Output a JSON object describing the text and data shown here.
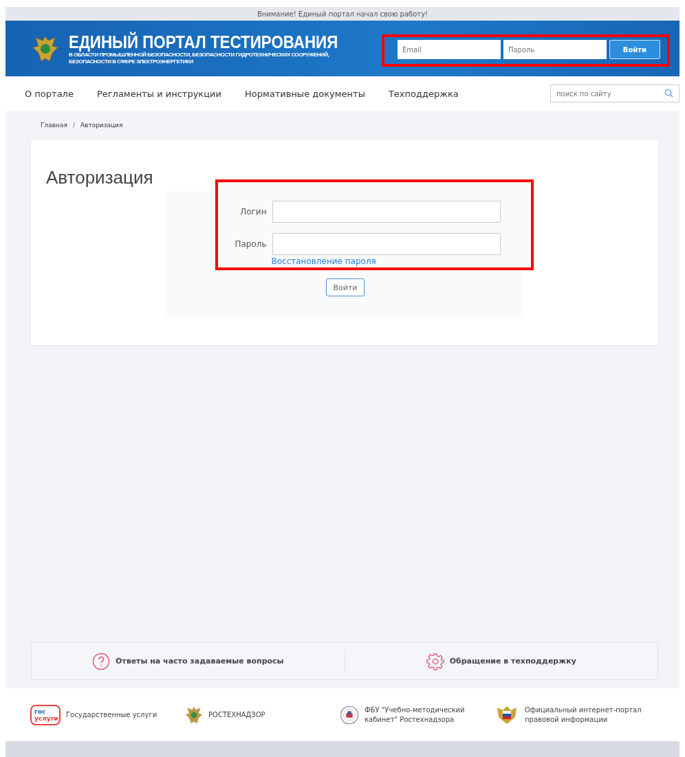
{
  "notice": "Внимание! Единый портал начал свою работу!",
  "header": {
    "title": "ЕДИНЫЙ ПОРТАЛ ТЕСТИРОВАНИЯ",
    "subtitle_lines": [
      "В ОБЛАСТИ ПРОМЫШЛЕННОЙ БЕЗОПАСНОСТИ, БЕЗОПАСНОСТИ ГИДРОТЕХНИЧЕСКИХ СООРУЖЕНИЙ,",
      "БЕЗОПАСНОСТИ В СФЕРЕ ЭЛЕКТРОЭНЕРГЕТИКИ"
    ],
    "email_placeholder": "Email",
    "password_placeholder": "Пароль",
    "login_button": "Войти"
  },
  "nav": {
    "items": [
      "О портале",
      "Регламенты и инструкции",
      "Нормативные документы",
      "Техподдержка"
    ],
    "search": {
      "placeholder": "поиск по сайту"
    }
  },
  "breadcrumbs": [
    "Главная",
    "Авторизация"
  ],
  "breadcrumb_separator": "/",
  "auth": {
    "title": "Авторизация",
    "fields": [
      {
        "label": "Логин"
      },
      {
        "label": "Пароль"
      }
    ],
    "recover_link": "Восстановление пароля",
    "submit": "Войти"
  },
  "help": [
    {
      "kind": "question",
      "label": "Ответы на часто задаваемые вопросы"
    },
    {
      "kind": "gear",
      "label": "Обращение в техподдержку"
    }
  ],
  "partners": [
    {
      "kind": "gosuslugi",
      "lines": [
        "Государственные услуги"
      ],
      "logo_text": [
        "гос",
        "услуги"
      ]
    },
    {
      "kind": "emblem",
      "lines": [
        "РОСТЕХНАДЗОР"
      ]
    },
    {
      "kind": "seal",
      "lines": [
        "ФБУ \"Учебно-методический",
        "кабинет\" Ростехнадзора"
      ]
    },
    {
      "kind": "flag",
      "lines": [
        "Официальный интернет-портал",
        "правовой информации"
      ]
    }
  ]
}
